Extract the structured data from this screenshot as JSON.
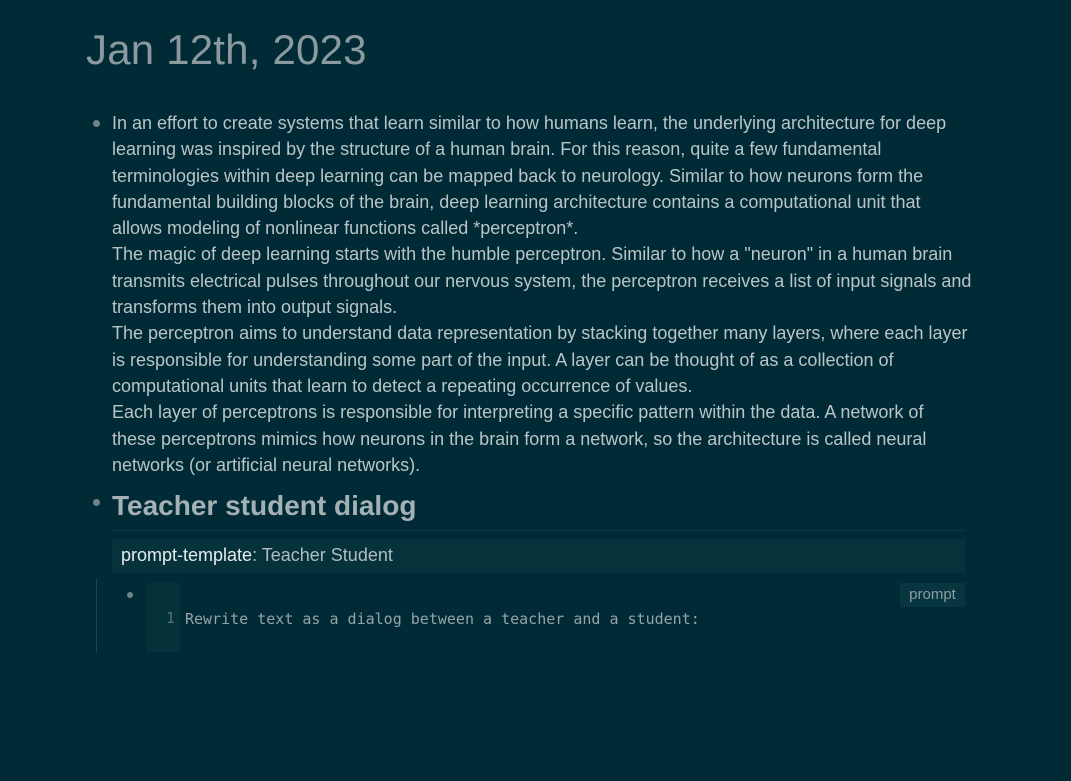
{
  "page": {
    "title": "Jan 12th, 2023"
  },
  "blocks": {
    "intro": {
      "paragraphs": [
        "In an effort to create systems that learn similar to how humans learn, the underlying architecture for deep learning was inspired by the structure of a human brain. For this reason, quite a few fundamental terminologies within deep learning can be mapped back to neurology. Similar to how neurons form the fundamental building blocks of the brain, deep learning architecture contains a computational unit that allows modeling of nonlinear functions called *perceptron*.",
        "The magic of deep learning starts with the humble perceptron. Similar to how a \"neuron\" in a human brain transmits electrical pulses throughout our nervous system, the perceptron receives a list of input signals and transforms them into output signals.",
        "The perceptron aims to understand data representation by stacking together many layers, where each layer is responsible for understanding some part of the input. A layer can be thought of as a collection of computational units that learn to detect a repeating occurrence of values.",
        "Each layer of perceptrons is responsible for interpreting a specific pattern within the data. A network of these perceptrons mimics how neurons in the brain form a network, so the architecture is called neural networks (or artificial neural networks)."
      ]
    },
    "dialog": {
      "heading": "Teacher student dialog",
      "property": {
        "key": "prompt-template",
        "separator": ":",
        "value": "Teacher Student"
      },
      "code": {
        "lang": "prompt",
        "line_number": "1",
        "line": "Rewrite text as a dialog between a teacher and a student:"
      }
    }
  }
}
